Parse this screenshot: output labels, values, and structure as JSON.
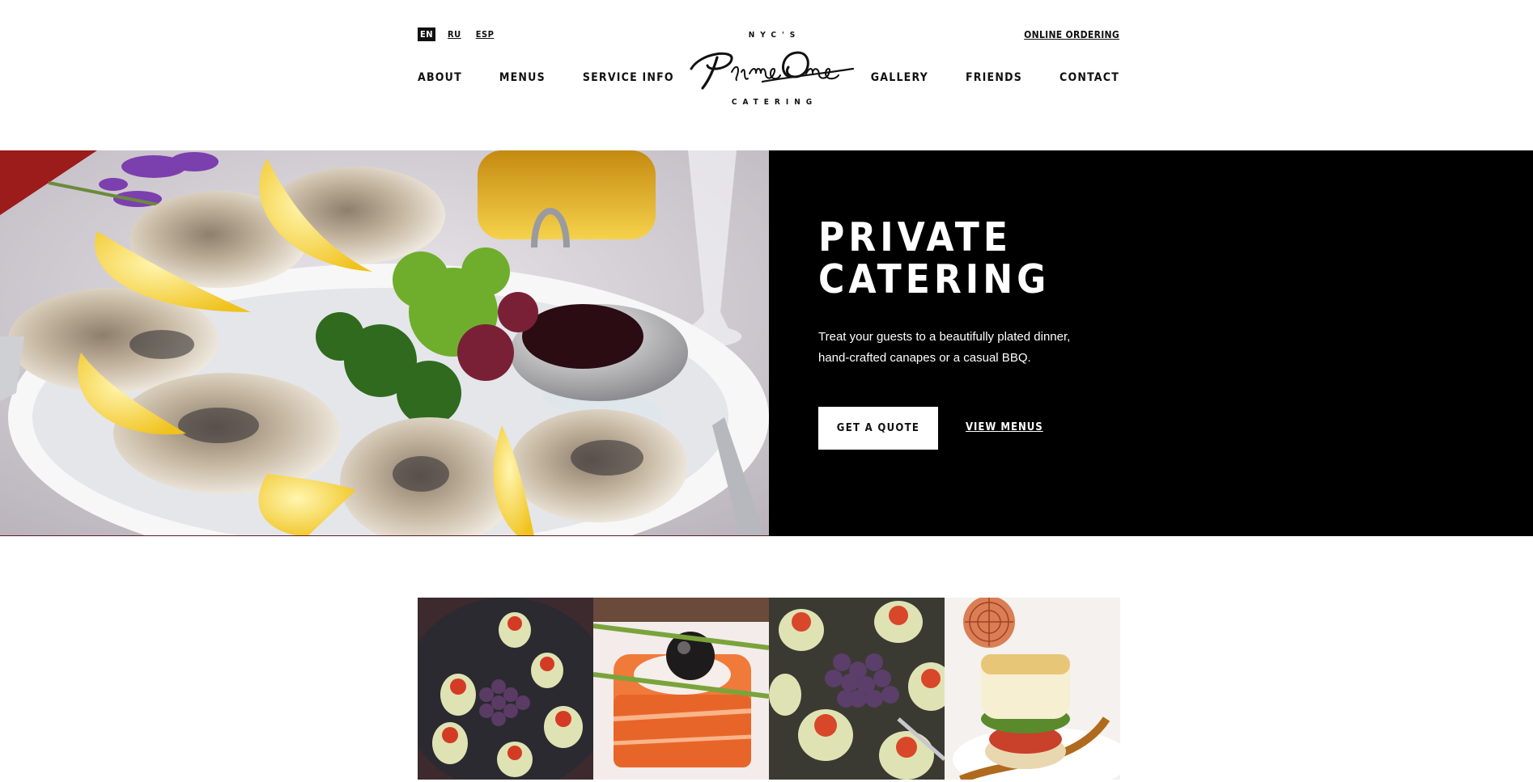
{
  "header": {
    "languages": [
      {
        "label": "EN",
        "active": true
      },
      {
        "label": "RU",
        "active": false
      },
      {
        "label": "ESP",
        "active": false
      }
    ],
    "online_ordering": "ONLINE ORDERING",
    "nav_left": [
      "ABOUT",
      "MENUS",
      "SERVICE INFO"
    ],
    "nav_right": [
      "GALLERY",
      "FRIENDS",
      "CONTACT"
    ],
    "logo": {
      "top_text": "NYC'S",
      "script_text": "PrimeOne",
      "bottom_text": "CATERING"
    }
  },
  "hero": {
    "title_line1": "PRIVATE",
    "title_line2": "CATERING",
    "description": "Treat your guests to a beautifully plated dinner, hand-crafted canapes or a casual BBQ.",
    "primary_button": "GET A QUOTE",
    "secondary_link": "VIEW MENUS",
    "image_icon": "oysters-platter-photo"
  },
  "gallery_strip": {
    "tiles": [
      {
        "icon": "canapes-grapes-photo"
      },
      {
        "icon": "salmon-canape-photo"
      },
      {
        "icon": "canapes-grapes-closeup-photo"
      },
      {
        "icon": "fish-tower-dish-photo"
      }
    ]
  }
}
